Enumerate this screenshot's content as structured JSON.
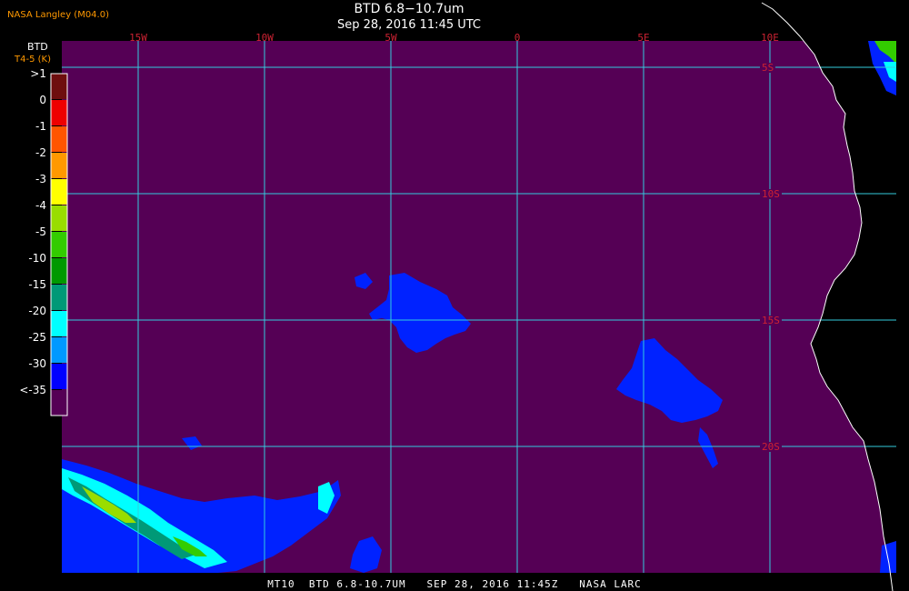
{
  "header": {
    "agency": "NASA Langley (M04.0)",
    "title": "BTD 6.8−10.7um",
    "subtitle": "Sep 28, 2016 11:45 UTC"
  },
  "legend": {
    "variable": "BTD",
    "units": "T4-5 (K)",
    "levels": [
      {
        "label": ">1",
        "color": "#6e0e0e"
      },
      {
        "label": "0",
        "color": "#ee0000"
      },
      {
        "label": "-1",
        "color": "#ff5500"
      },
      {
        "label": "-2",
        "color": "#ff9900"
      },
      {
        "label": "-3",
        "color": "#ffff00"
      },
      {
        "label": "-4",
        "color": "#99dd00"
      },
      {
        "label": "-5",
        "color": "#33cc00"
      },
      {
        "label": "-10",
        "color": "#009900"
      },
      {
        "label": "-15",
        "color": "#009977"
      },
      {
        "label": "-20",
        "color": "#00ffff"
      },
      {
        "label": "-25",
        "color": "#0099ff"
      },
      {
        "label": "-30",
        "color": "#0000ff"
      },
      {
        "label": "<-35",
        "color": "#550055"
      }
    ]
  },
  "map": {
    "background_color": "#550055",
    "grid_color": "#33ccdd",
    "coast_color": "#ffffff",
    "lon_labels": [
      "15W",
      "10W",
      "5W",
      "0",
      "5E",
      "10E"
    ],
    "lat_labels": [
      "5S",
      "10S",
      "15S",
      "20S"
    ]
  },
  "footer": {
    "text": "MT10  BTD 6.8-10.7UM   SEP 28, 2016 11:45Z   NASA LARC"
  }
}
